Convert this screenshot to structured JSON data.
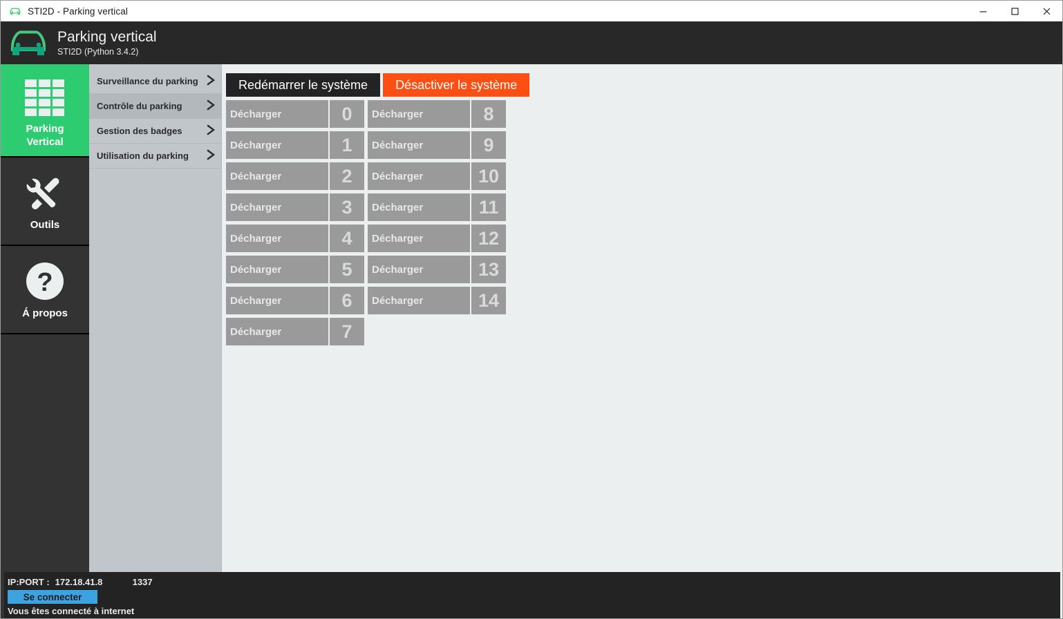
{
  "window": {
    "titlebar_text": "STI2D - Parking vertical",
    "titlebar_icon": "car-icon",
    "minimize_label": "minimize-icon",
    "maximize_label": "maximize-icon",
    "close_label": "close-icon"
  },
  "header": {
    "logo_icon": "car-icon",
    "title": "Parking vertical",
    "subtitle": "STI2D (Python 3.4.2)"
  },
  "colors": {
    "accent_green": "#2ecc71",
    "header_dark": "#282828",
    "rail_dark": "#333333",
    "menu_panel": "#c0c6c9",
    "content_bg": "#eceff0",
    "slot_gray": "#9a9a9a",
    "danger_orange": "#fb4f14",
    "connect_blue": "#3da3e0"
  },
  "rail": {
    "items": [
      {
        "label": "Parking\nVertical",
        "label_line1": "Parking",
        "label_line2": "Vertical",
        "icon": "parking-grid-icon",
        "active": true
      },
      {
        "label": "Outils",
        "icon": "tools-icon",
        "active": false
      },
      {
        "label": "Á propos",
        "icon": "question-mark-icon",
        "active": false
      }
    ]
  },
  "menu": {
    "items": [
      {
        "label": "Surveillance du parking",
        "icon": "chevron-right-icon",
        "selected": false
      },
      {
        "label": "Contrôle du parking",
        "icon": "chevron-right-icon",
        "selected": true
      },
      {
        "label": "Gestion des badges",
        "icon": "chevron-right-icon",
        "selected": false
      },
      {
        "label": "Utilisation du parking",
        "icon": "chevron-right-icon",
        "selected": false
      }
    ]
  },
  "toolbar": {
    "restart_label": "Redémarrer le système",
    "disable_label": "Désactiver le système"
  },
  "slots": {
    "discharge_label": "Décharger",
    "column_left": [
      "0",
      "1",
      "2",
      "3",
      "4",
      "5",
      "6",
      "7"
    ],
    "column_right": [
      "8",
      "9",
      "10",
      "11",
      "12",
      "13",
      "14"
    ]
  },
  "status": {
    "ip_label": "IP:PORT :",
    "ip_value": "172.18.41.8",
    "port_value": "1337",
    "connect_label": "Se connecter",
    "message": "Vous êtes connecté à internet"
  }
}
